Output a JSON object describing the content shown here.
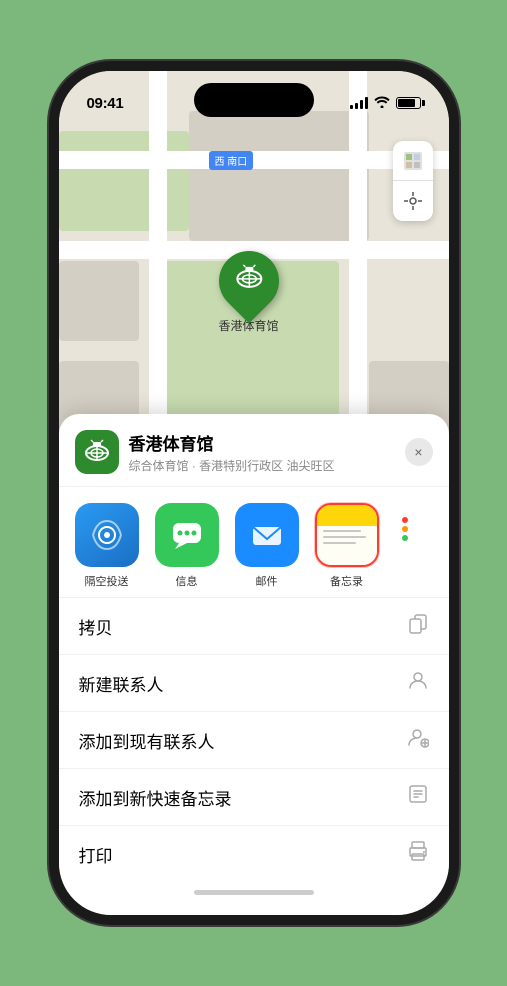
{
  "phone": {
    "time": "09:41",
    "status_arrow": "▶"
  },
  "map": {
    "label": "南口",
    "label_prefix": "西",
    "venue_pin": "🏟",
    "venue_label": "香港体育馆",
    "map_btn_layer": "🗺",
    "map_btn_location": "⬆"
  },
  "bottom_sheet": {
    "venue_icon": "🏟",
    "venue_name": "香港体育馆",
    "venue_sub": "综合体育馆 · 香港特别行政区 油尖旺区",
    "close_label": "×"
  },
  "share_actions": [
    {
      "id": "airdrop",
      "type": "airdrop",
      "icon": "📡",
      "label": "隔空投送"
    },
    {
      "id": "messages",
      "type": "messages",
      "icon": "💬",
      "label": "信息"
    },
    {
      "id": "mail",
      "type": "mail",
      "icon": "✉",
      "label": "邮件"
    },
    {
      "id": "notes",
      "type": "notes-selected",
      "icon": "notes",
      "label": "备忘录"
    }
  ],
  "more_dots_colors": [
    "#ff3b30",
    "#ff9500",
    "#34c759"
  ],
  "action_rows": [
    {
      "label": "拷贝",
      "icon": "copy"
    },
    {
      "label": "新建联系人",
      "icon": "contact"
    },
    {
      "label": "添加到现有联系人",
      "icon": "add-contact"
    },
    {
      "label": "添加到新快速备忘录",
      "icon": "note"
    },
    {
      "label": "打印",
      "icon": "print"
    }
  ]
}
